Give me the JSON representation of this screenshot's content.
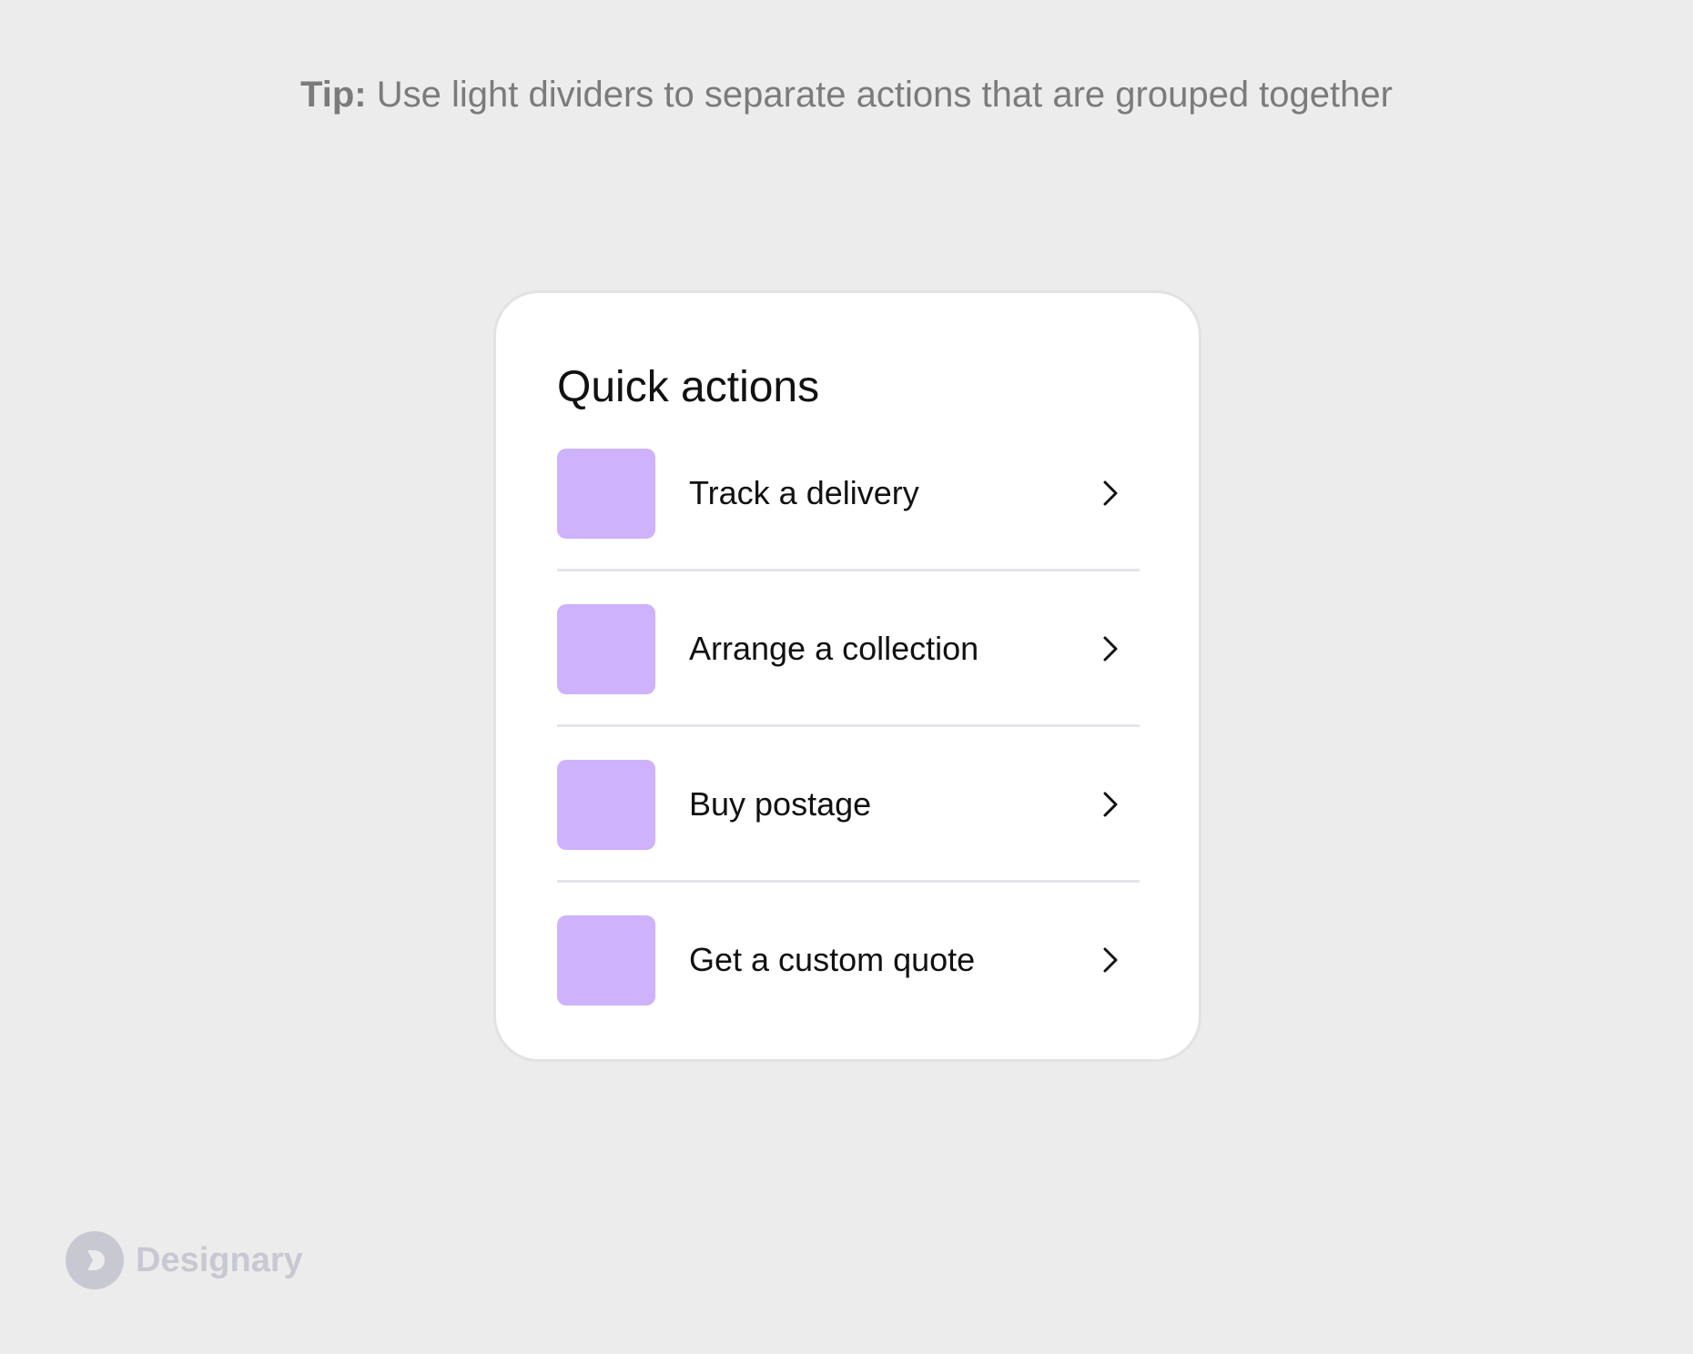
{
  "tip": {
    "label": "Tip:",
    "text": " Use light dividers to separate actions that are grouped together"
  },
  "card": {
    "title": "Quick actions",
    "icon_color": "#ceb2fb",
    "actions": [
      {
        "label": "Track a delivery",
        "icon": "chevron-right-icon"
      },
      {
        "label": "Arrange a collection",
        "icon": "chevron-right-icon"
      },
      {
        "label": "Buy postage",
        "icon": "chevron-right-icon"
      },
      {
        "label": "Get a custom quote",
        "icon": "chevron-right-icon"
      }
    ]
  },
  "brand": {
    "name": "Designary",
    "logo_icon": "designary-logo-icon",
    "color": "#c8c8d3"
  }
}
